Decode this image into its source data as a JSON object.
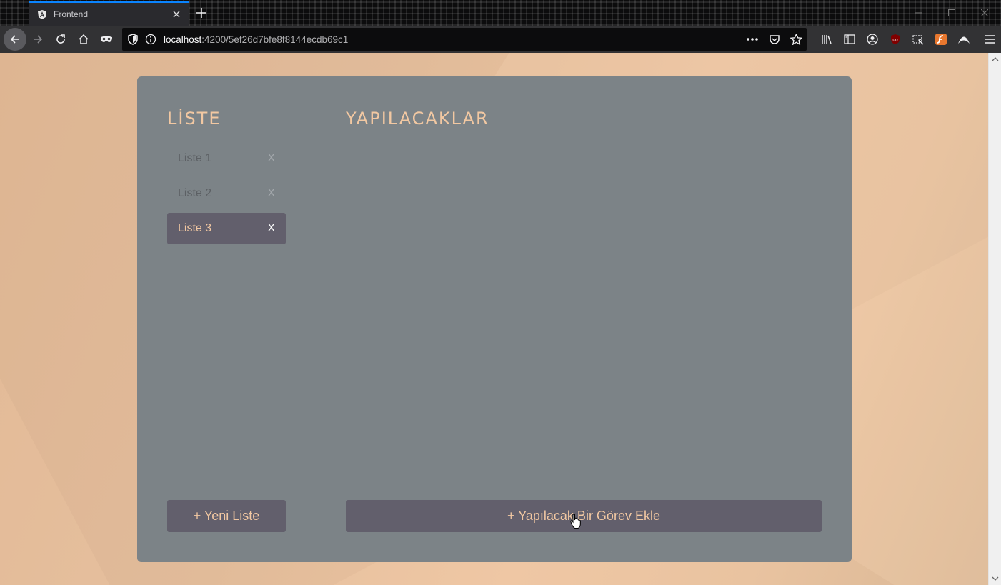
{
  "browser": {
    "tab_title": "Frontend",
    "url_host": "localhost",
    "url_path": ":4200/5ef26d7bfe8f8144ecdb69c1"
  },
  "lists": {
    "heading": "LİSTE",
    "items": [
      {
        "label": "Liste 1",
        "delete": "X",
        "active": false
      },
      {
        "label": "Liste 2",
        "delete": "X",
        "active": false
      },
      {
        "label": "Liste 3",
        "delete": "X",
        "active": true
      }
    ],
    "new_button": "+ Yeni Liste"
  },
  "tasks": {
    "heading": "YAPILACAKLAR",
    "add_button": "+ Yapılacak Bir Görev Ekle"
  },
  "colors": {
    "card": "#7c8387",
    "accent_text": "#f2c8a2",
    "button_bg": "#625f6c"
  }
}
